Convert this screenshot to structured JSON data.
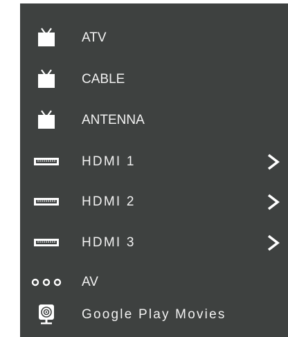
{
  "menu": {
    "items": [
      {
        "label": "ATV",
        "icon": "tv-icon",
        "has_submenu": false
      },
      {
        "label": "CABLE",
        "icon": "tv-icon",
        "has_submenu": false
      },
      {
        "label": "ANTENNA",
        "icon": "tv-icon",
        "has_submenu": false
      },
      {
        "label": "HDMI 1",
        "icon": "hdmi-port-icon",
        "has_submenu": true
      },
      {
        "label": "HDMI 2",
        "icon": "hdmi-port-icon",
        "has_submenu": true
      },
      {
        "label": "HDMI 3",
        "icon": "hdmi-port-icon",
        "has_submenu": true
      },
      {
        "label": "AV",
        "icon": "av-jacks-icon",
        "has_submenu": false
      },
      {
        "label": "Google Play Movies",
        "icon": "google-play-movies-icon",
        "has_submenu": false
      }
    ]
  },
  "colors": {
    "panel_background": "#3e4140",
    "text": "#f2f2f2",
    "icon": "#ffffff"
  }
}
